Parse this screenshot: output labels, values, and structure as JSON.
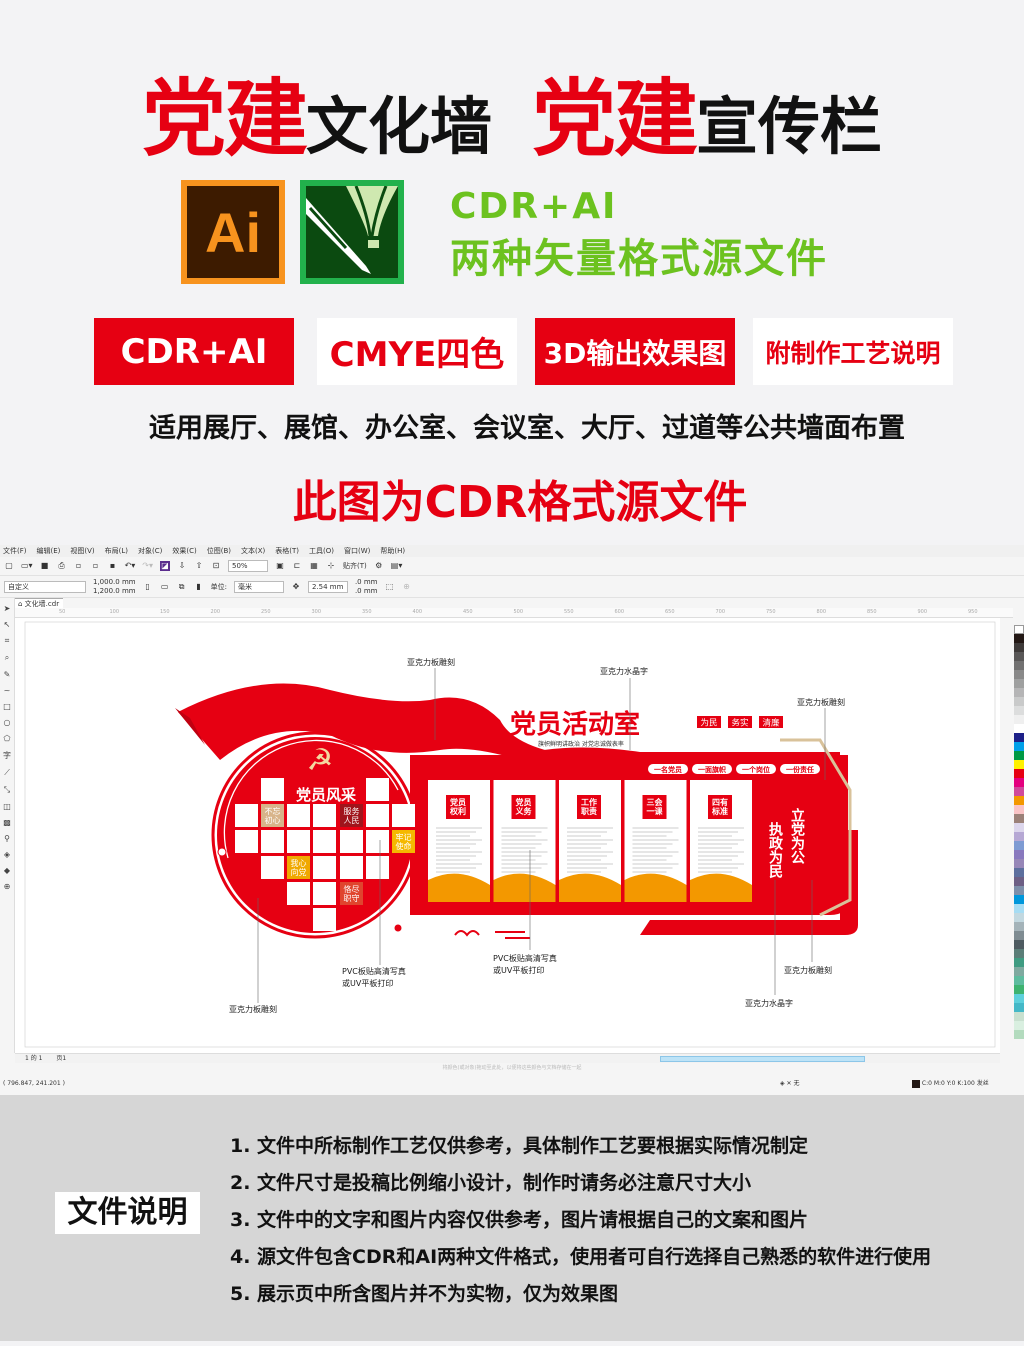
{
  "header": {
    "title_parts": [
      {
        "text": "党建",
        "style": "red"
      },
      {
        "text": "文化墙",
        "style": "black"
      },
      {
        "text": "党建",
        "style": "red"
      },
      {
        "text": "宣传栏",
        "style": "black"
      }
    ]
  },
  "logos": {
    "ai": "Ai",
    "cdr": "coreldraw-icon"
  },
  "formats": {
    "line1": "CDR+AI",
    "line2": "两种矢量格式源文件"
  },
  "badges": [
    {
      "text": "CDR+AI",
      "style": "red"
    },
    {
      "text": "CMYE四色",
      "style": "white"
    },
    {
      "text": "3D输出效果图",
      "style": "red"
    },
    {
      "text": "附制作工艺说明",
      "style": "white"
    }
  ],
  "usage": "适用展厅、展馆、办公室、会议室、大厅、过道等公共墙面布置",
  "cdr_note": "此图为CDR格式源文件",
  "app": {
    "menu": [
      "文件(F)",
      "编辑(E)",
      "视图(V)",
      "布局(L)",
      "对象(C)",
      "效果(C)",
      "位图(B)",
      "文本(X)",
      "表格(T)",
      "工具(O)",
      "窗口(W)",
      "帮助(H)"
    ],
    "zoom": "50%",
    "snap": "贴齐(T)",
    "preset": "自定义",
    "width": "1,000.0 mm",
    "height": "1,200.0 mm",
    "unit_label": "单位:",
    "unit": "毫米",
    "nudge": "2.54 mm",
    "dup_x": ".0 mm",
    "dup_y": ".0 mm",
    "doc_tab": "文化墙.cdr",
    "ruler_ticks": [
      "50",
      "100",
      "150",
      "200",
      "250",
      "300",
      "350",
      "400",
      "450",
      "500",
      "550",
      "600",
      "650",
      "700",
      "750",
      "800",
      "850",
      "900",
      "950"
    ],
    "page_nav": "1 的 1",
    "page_tab": "页1",
    "hint": "将颜色(或对象)拖动至此处，以便将这些颜色与文档存储在一起",
    "coords": "( 796.847, 241.201 )",
    "fill_none": "无",
    "color_info": "C:0 M:0 Y:0 K:100 发丝",
    "palette": [
      "#231815",
      "#3e3a39",
      "#595757",
      "#727171",
      "#898989",
      "#9fa0a0",
      "#b5b5b6",
      "#c9caca",
      "#dcdddd",
      "#efefef",
      "#ffffff",
      "#1d2088",
      "#00a0e9",
      "#009944",
      "#fff100",
      "#e60012",
      "#e4007f",
      "#d04a9c",
      "#f39800",
      "#f9c4c6",
      "#9b8178",
      "#dcd6ec",
      "#b6a8d4",
      "#7e9bd3",
      "#8979be",
      "#9787b8",
      "#5d6f9e",
      "#6d5f85",
      "#7d8faa",
      "#0097db",
      "#a6dcf3",
      "#c2d8e0",
      "#a4b3b9",
      "#7f8c92",
      "#4e5b61",
      "#5b7e78",
      "#3f9c82",
      "#7faaa0",
      "#5ebc9f",
      "#3eb370",
      "#5dd0db",
      "#44b8c7",
      "#c8e0cf",
      "#d9efe0",
      "#b3dbbe"
    ]
  },
  "design": {
    "title": "党员活动室",
    "slogan": "旗帜鲜明讲政治  对党忠诚做表率",
    "tags": [
      "为民",
      "务实",
      "清廉"
    ],
    "pills": [
      "一名党员",
      "一面旗帜",
      "一个岗位",
      "一份责任"
    ],
    "heart_title": "党员风采",
    "heart_words": [
      "不忘初心",
      "服务人民",
      "牢记使命",
      "我心向党",
      "恪尽职守"
    ],
    "panels": [
      "党员权利",
      "党员义务",
      "工作职责",
      "三会一课",
      "四有标准"
    ],
    "motto_col1": "立党为公",
    "motto_col2": "执政为民",
    "callouts": [
      "亚克力板雕刻",
      "亚克力水晶字",
      "亚克力板雕刻",
      "PVC板贴高清写真",
      "或UV平板打印",
      "PVC板贴高清写真",
      "或UV平板打印",
      "亚克力板雕刻",
      "亚克力水晶字",
      "亚克力板雕刻"
    ]
  },
  "notes_section": {
    "label": "文件说明",
    "items": [
      "1. 文件中所标制作工艺仅供参考，具体制作工艺要根据实际情况制定",
      "2. 文件尺寸是投稿比例缩小设计，制作时请务必注意尺寸大小",
      "3. 文件中的文字和图片内容仅供参考，图片请根据自己的文案和图片",
      "4. 源文件包含CDR和AI两种文件格式，使用者可自行选择自己熟悉的软件进行使用",
      "5. 展示页中所含图片并不为实物，仅为效果图"
    ]
  },
  "colors": {
    "brand_red": "#e60012",
    "format_green": "#6cc21f",
    "ai_orange": "#f7931e",
    "ai_bg": "#3d1b00",
    "cdr_green": "#22b14c",
    "cdr_bg": "#0b4a10"
  }
}
